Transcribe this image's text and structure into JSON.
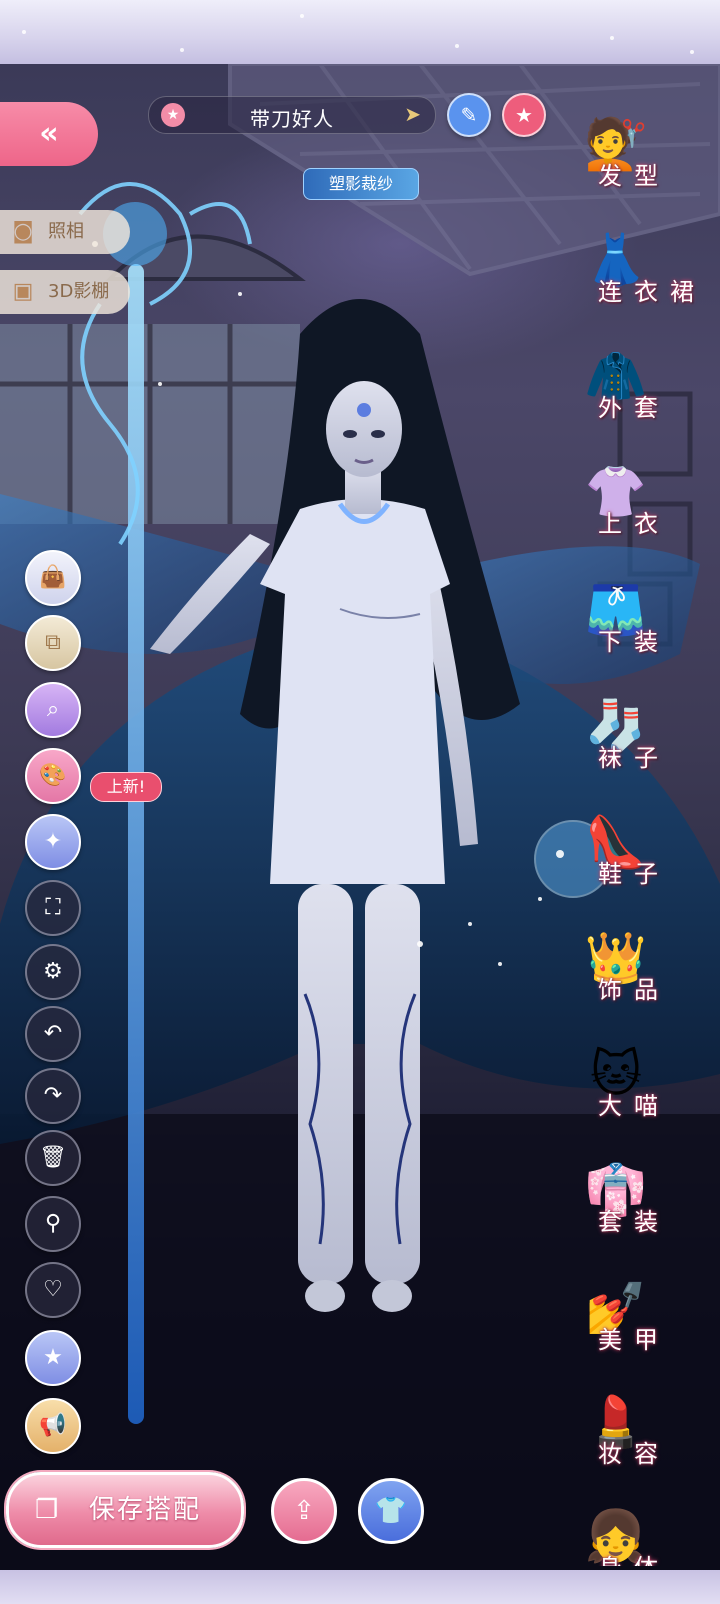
{
  "header": {
    "outfit_name": "带刀好人",
    "star_icon": "star-icon",
    "next_icon": "chevron-right-icon",
    "edit_icon": "pencil-icon",
    "favorite_icon": "star-icon",
    "event_tag": "塑影裁纱"
  },
  "left_menu": {
    "back_icon": "double-chevron-left-icon",
    "photo_label": "照相",
    "studio_label": "3D影棚",
    "new_badge": "上新!",
    "tools": [
      {
        "name": "bag-icon"
      },
      {
        "name": "layers-icon"
      },
      {
        "name": "magnify-sparkle-icon"
      },
      {
        "name": "palette-icon"
      },
      {
        "name": "star-wand-icon"
      },
      {
        "name": "fullscreen-icon"
      },
      {
        "name": "gear-icon"
      },
      {
        "name": "undo-icon"
      },
      {
        "name": "redo-icon"
      },
      {
        "name": "trash-icon"
      },
      {
        "name": "search-icon"
      },
      {
        "name": "heart-icon"
      },
      {
        "name": "star-circle-icon"
      },
      {
        "name": "megaphone-icon"
      }
    ]
  },
  "categories": [
    {
      "label": "发型",
      "icon": "hair-icon"
    },
    {
      "label": "连衣裙",
      "icon": "dress-icon"
    },
    {
      "label": "外套",
      "icon": "coat-icon"
    },
    {
      "label": "上衣",
      "icon": "shirt-icon"
    },
    {
      "label": "下装",
      "icon": "shorts-icon"
    },
    {
      "label": "袜子",
      "icon": "sock-icon"
    },
    {
      "label": "鞋子",
      "icon": "shoe-icon"
    },
    {
      "label": "饰品",
      "icon": "tiara-icon"
    },
    {
      "label": "大喵",
      "icon": "cat-icon"
    },
    {
      "label": "套装",
      "icon": "outfit-set-icon"
    },
    {
      "label": "美甲",
      "icon": "nail-polish-icon"
    },
    {
      "label": "妆容",
      "icon": "makeup-icon"
    },
    {
      "label": "身体",
      "icon": "body-icon"
    }
  ],
  "bottom": {
    "save_label": "保存搭配",
    "save_icon": "outfit-card-icon",
    "share_icon": "share-icon",
    "wardrobe_icon": "wardrobe-icon"
  },
  "colors": {
    "accent_pink": "#ee6589",
    "accent_blue": "#4a6edc",
    "frame": "#d7d3ec"
  }
}
